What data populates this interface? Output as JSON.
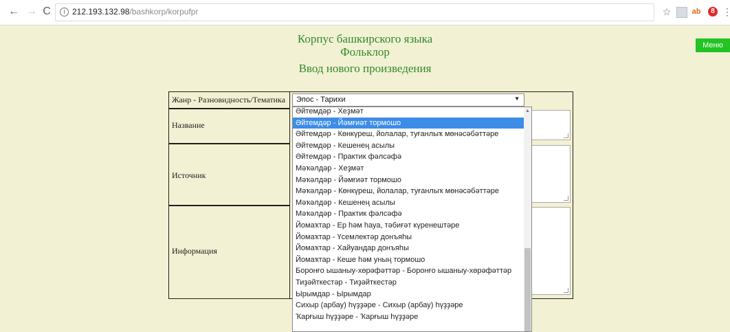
{
  "browser": {
    "back": "←",
    "forward": "→",
    "reload": "C",
    "info": "i",
    "url_host": "212.193.132.98",
    "url_path": "/bashkorp/korpufpr",
    "star": "☆",
    "ext_text": "ab",
    "ext_badge": "8",
    "more": "⋮"
  },
  "page": {
    "title1": "Корпус башкирского языка",
    "title2": "Фольклор",
    "title3": "Ввод нового произведения",
    "menu_label": "Меню"
  },
  "form": {
    "genre_label": "Жанр - Разновидность/Тематика",
    "name_label": "Название",
    "source_label": "Источник",
    "info_label": "Информация",
    "genre_value": "Эпос - Тарихи",
    "arrow": "▼"
  },
  "dropdown": {
    "up_arrow": "▲",
    "options": [
      "Әйтемдәр - Хеҙмәт",
      "Әйтемдәр - Йәмғиәт тормошо",
      "Әйтемдәр - Көнкүреш, йолалар, туғанлыҡ мөнәсәбәттәре",
      "Әйтемдәр - Кешенең асылы",
      "Әйтемдәр - Практик фәлсәфә",
      "Мәҡәлдәр - Хеҙмәт",
      "Мәҡәлдәр - Йәмғиәт тормошо",
      "Мәҡәлдәр - Көнкүреш, йолалар, туғанлыҡ мөнәсәбәттәре",
      "Мәҡәлдәр - Кешенең асылы",
      "Мәҡәлдәр - Практик фәлсәфә",
      "Йомаҡтар - Ер һәм һауа, тәбиғәт күренештәре",
      "Йомаҡтар - Үсемлектәр донъяһы",
      "Йомаҡтар - Хайуандар донъяһы",
      "Йомаҡтар - Кеше һәм уның тормошо",
      "Боронғо ышаныу-хөрәфәттәр - Боронғо ышаныу-хөрәфәттәр",
      "Тиҙәйткестәр - Тиҙәйткестәр",
      "Ырымдар - Ырымдар",
      "Сихыр (арбау) һүҙҙәре - Сихыр (арбау) һүҙҙәре",
      "Ҡарғыш һүҙҙәре - Ҡарғыш һүҙҙәре"
    ],
    "selected_index": 1
  }
}
